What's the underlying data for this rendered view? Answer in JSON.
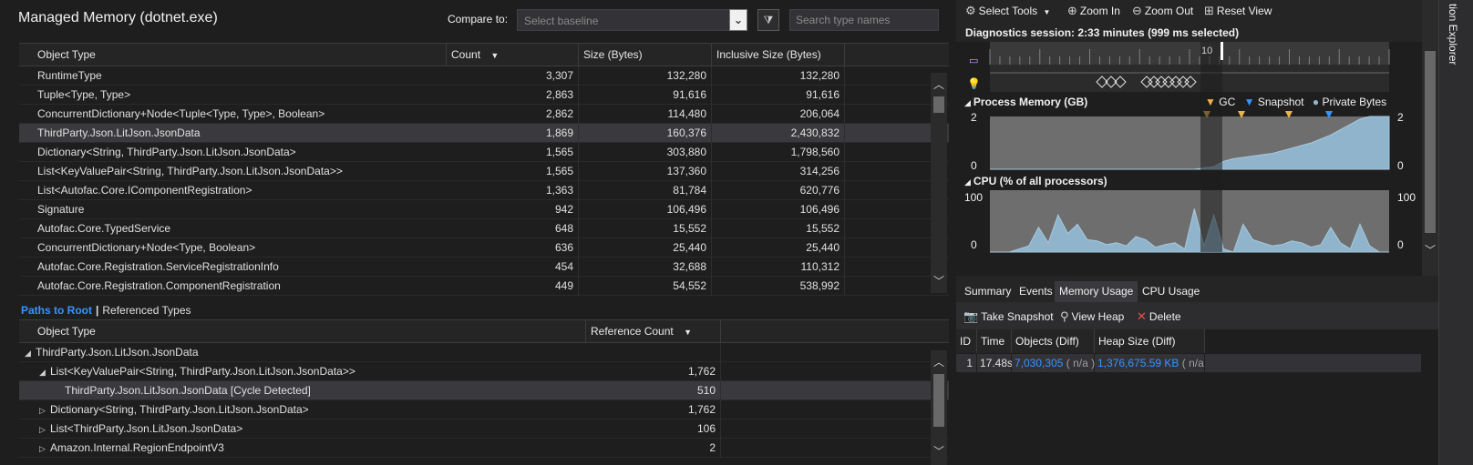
{
  "memory": {
    "title": "Managed Memory (dotnet.exe)",
    "compare_label": "Compare to:",
    "baseline_placeholder": "Select baseline",
    "search_placeholder": "Search type names",
    "columns": [
      "Object Type",
      "Count",
      "Size (Bytes)",
      "Inclusive Size (Bytes)"
    ],
    "sort_column": "Count",
    "rows": [
      {
        "type": "RuntimeType",
        "count": "3,307",
        "size": "132,280",
        "inclusive": "132,280"
      },
      {
        "type": "Tuple<Type, Type>",
        "count": "2,863",
        "size": "91,616",
        "inclusive": "91,616"
      },
      {
        "type": "ConcurrentDictionary+Node<Tuple<Type, Type>, Boolean>",
        "count": "2,862",
        "size": "114,480",
        "inclusive": "206,064"
      },
      {
        "type": "ThirdParty.Json.LitJson.JsonData",
        "count": "1,869",
        "size": "160,376",
        "inclusive": "2,430,832",
        "selected": true
      },
      {
        "type": "Dictionary<String, ThirdParty.Json.LitJson.JsonData>",
        "count": "1,565",
        "size": "303,880",
        "inclusive": "1,798,560"
      },
      {
        "type": "List<KeyValuePair<String, ThirdParty.Json.LitJson.JsonData>>",
        "count": "1,565",
        "size": "137,360",
        "inclusive": "314,256"
      },
      {
        "type": "List<Autofac.Core.IComponentRegistration>",
        "count": "1,363",
        "size": "81,784",
        "inclusive": "620,776"
      },
      {
        "type": "Signature",
        "count": "942",
        "size": "106,496",
        "inclusive": "106,496"
      },
      {
        "type": "Autofac.Core.TypedService",
        "count": "648",
        "size": "15,552",
        "inclusive": "15,552"
      },
      {
        "type": "ConcurrentDictionary+Node<Type, Boolean>",
        "count": "636",
        "size": "25,440",
        "inclusive": "25,440"
      },
      {
        "type": "Autofac.Core.Registration.ServiceRegistrationInfo",
        "count": "454",
        "size": "32,688",
        "inclusive": "110,312"
      },
      {
        "type": "Autofac.Core.Registration.ComponentRegistration",
        "count": "449",
        "size": "54,552",
        "inclusive": "538,992"
      }
    ]
  },
  "paths": {
    "tab_active": "Paths to Root",
    "tab_separator": "|",
    "tab_other": "Referenced Types",
    "columns": [
      "Object Type",
      "Reference Count"
    ],
    "sort_column": "Reference Count",
    "rows": [
      {
        "indent": 0,
        "expander": "expanded",
        "type": "ThirdParty.Json.LitJson.JsonData",
        "refcount": ""
      },
      {
        "indent": 1,
        "expander": "expanded",
        "type": "List<KeyValuePair<String, ThirdParty.Json.LitJson.JsonData>>",
        "refcount": "1,762"
      },
      {
        "indent": 2,
        "expander": "none",
        "type": "ThirdParty.Json.LitJson.JsonData [Cycle Detected]",
        "refcount": "510",
        "selected": true
      },
      {
        "indent": 1,
        "expander": "collapsed",
        "type": "Dictionary<String, ThirdParty.Json.LitJson.JsonData>",
        "refcount": "1,762"
      },
      {
        "indent": 1,
        "expander": "collapsed",
        "type": "List<ThirdParty.Json.LitJson.JsonData>",
        "refcount": "106"
      },
      {
        "indent": 1,
        "expander": "collapsed",
        "type": "Amazon.Internal.RegionEndpointV3",
        "refcount": "2"
      }
    ]
  },
  "diagnostics": {
    "toolbar": {
      "select_tools": "Select Tools",
      "zoom_in": "Zoom In",
      "zoom_out": "Zoom Out",
      "reset_view": "Reset View"
    },
    "session_text": "Diagnostics session: 2:33 minutes (999 ms selected)",
    "ruler_label": "10",
    "process_memory": {
      "title": "Process Memory (GB)",
      "legend": [
        "GC",
        "Snapshot",
        "Private Bytes"
      ],
      "ymax": "2",
      "ymin": "0",
      "private_bytes": [
        0.0,
        0.0,
        0.0,
        0.0,
        0.0,
        0.0,
        0.0,
        0.0,
        0.0,
        0.0,
        0.0,
        0.0,
        0.0,
        0.0,
        0.0,
        0.0,
        0.0,
        0.0,
        0.0,
        0.0,
        0.0,
        0.0,
        0.05,
        0.1,
        0.3,
        0.4,
        0.45,
        0.5,
        0.55,
        0.6,
        0.7,
        0.8,
        0.9,
        1.0,
        1.15,
        1.3,
        1.5,
        1.7,
        1.9,
        2.0,
        2.0,
        2.0
      ]
    },
    "cpu": {
      "title": "CPU (% of all processors)",
      "ymax": "100",
      "ymin": "0",
      "usage": [
        0,
        0,
        0,
        5,
        10,
        40,
        15,
        60,
        30,
        45,
        20,
        18,
        12,
        15,
        10,
        25,
        20,
        8,
        12,
        15,
        5,
        70,
        10,
        60,
        5,
        0,
        45,
        20,
        15,
        10,
        12,
        18,
        15,
        8,
        12,
        40,
        15,
        5,
        45,
        10,
        0,
        0
      ]
    },
    "tabs": [
      "Summary",
      "Events",
      "Memory Usage",
      "CPU Usage"
    ],
    "active_tab": "Memory Usage",
    "snapshot_toolbar": {
      "take_snapshot": "Take Snapshot",
      "view_heap": "View Heap",
      "delete": "Delete"
    },
    "snapshot_columns": [
      "ID",
      "Time",
      "Objects (Diff)",
      "Heap Size (Diff)"
    ],
    "snapshots": [
      {
        "id": "1",
        "time": "17.48s",
        "objects": "7,030,305",
        "objects_diff": "( n/a )",
        "heap": "1,376,675.59 KB",
        "heap_diff": "( n/a )"
      }
    ]
  },
  "side_panel": {
    "label": "tion Explorer"
  },
  "colors": {
    "link": "#3794ff",
    "chart_fill": "#8fb4cc",
    "gc_marker": "#e9b44c",
    "snapshot_marker": "#3794ff"
  }
}
